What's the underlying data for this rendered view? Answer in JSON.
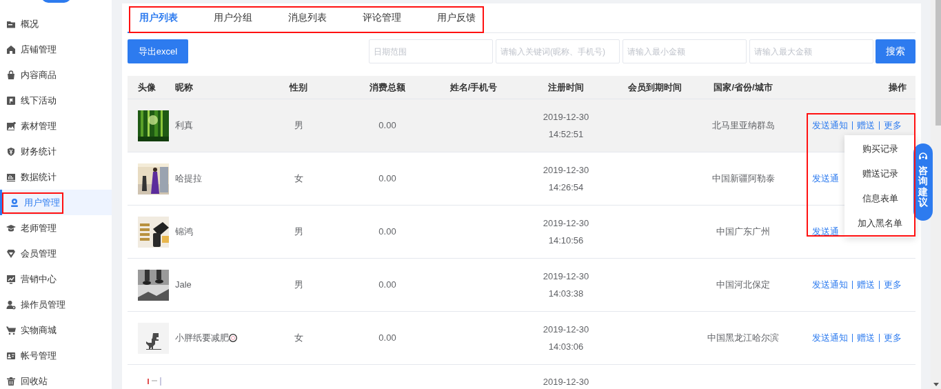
{
  "sidebar": {
    "items": [
      {
        "label": "概况",
        "selected": false
      },
      {
        "label": "店铺管理",
        "selected": false
      },
      {
        "label": "内容商品",
        "selected": false
      },
      {
        "label": "线下活动",
        "selected": false
      },
      {
        "label": "素材管理",
        "selected": false
      },
      {
        "label": "财务统计",
        "selected": false
      },
      {
        "label": "数据统计",
        "selected": false
      },
      {
        "label": "用户管理",
        "selected": true
      },
      {
        "label": "老师管理",
        "selected": false
      },
      {
        "label": "会员管理",
        "selected": false
      },
      {
        "label": "营销中心",
        "selected": false
      },
      {
        "label": "操作员管理",
        "selected": false
      },
      {
        "label": "实物商城",
        "selected": false
      },
      {
        "label": "帐号管理",
        "selected": false
      },
      {
        "label": "回收站",
        "selected": false
      }
    ]
  },
  "tabs": [
    {
      "label": "用户列表",
      "selected": true
    },
    {
      "label": "用户分组",
      "selected": false
    },
    {
      "label": "消息列表",
      "selected": false
    },
    {
      "label": "评论管理",
      "selected": false
    },
    {
      "label": "用户反馈",
      "selected": false
    }
  ],
  "toolbar": {
    "export_button": "导出excel",
    "filters": [
      {
        "placeholder": "日期范围"
      },
      {
        "placeholder": "请输入关键词(昵称、手机号)"
      },
      {
        "placeholder": "请输入最小金额"
      },
      {
        "placeholder": "请输入最大金额"
      }
    ],
    "search_button": "搜索"
  },
  "table": {
    "columns": [
      "头像",
      "昵称",
      "性别",
      "消费总额",
      "姓名/手机号",
      "注册时间",
      "会员到期时间",
      "国家/省份/城市",
      "操作"
    ],
    "rows": [
      {
        "nickname": "利真",
        "emoji": false,
        "sex": "男",
        "total": "0.00",
        "reg_date": "2019-12-30",
        "reg_time": "14:52:51",
        "region": "北马里亚纳群岛",
        "hovered": true,
        "actions": [
          "发送通知",
          "赠送",
          "更多"
        ]
      },
      {
        "nickname": "哈提拉",
        "emoji": false,
        "sex": "女",
        "total": "0.00",
        "reg_date": "2019-12-30",
        "reg_time": "14:26:54",
        "region": "中国新疆阿勒泰",
        "hovered": false,
        "actions": [
          "发送通"
        ]
      },
      {
        "nickname": "锦鸿",
        "emoji": false,
        "sex": "男",
        "total": "0.00",
        "reg_date": "2019-12-30",
        "reg_time": "14:10:56",
        "region": "中国广东广州",
        "hovered": false,
        "actions": [
          "发送通"
        ]
      },
      {
        "nickname": "Jale",
        "emoji": false,
        "sex": "男",
        "total": "0.00",
        "reg_date": "2019-12-30",
        "reg_time": "14:03:38",
        "region": "中国河北保定",
        "hovered": false,
        "actions": [
          "发送通知",
          "赠送",
          "更多"
        ]
      },
      {
        "nickname": "小胖纸要减肥",
        "emoji": true,
        "sex": "女",
        "total": "0.00",
        "reg_date": "2019-12-30",
        "reg_time": "14:03:06",
        "region": "中国黑龙江哈尔滨",
        "hovered": false,
        "actions": [
          "发送通知",
          "赠送",
          "更多"
        ]
      },
      {
        "emoji": false,
        "reg_date": "2019-12-30",
        "hovered": false
      }
    ]
  },
  "more_menu": {
    "items": [
      "购买记录",
      "赠送记录",
      "信息表单",
      "加入黑名单"
    ]
  },
  "feedback_tab": {
    "label": "咨询建议"
  }
}
